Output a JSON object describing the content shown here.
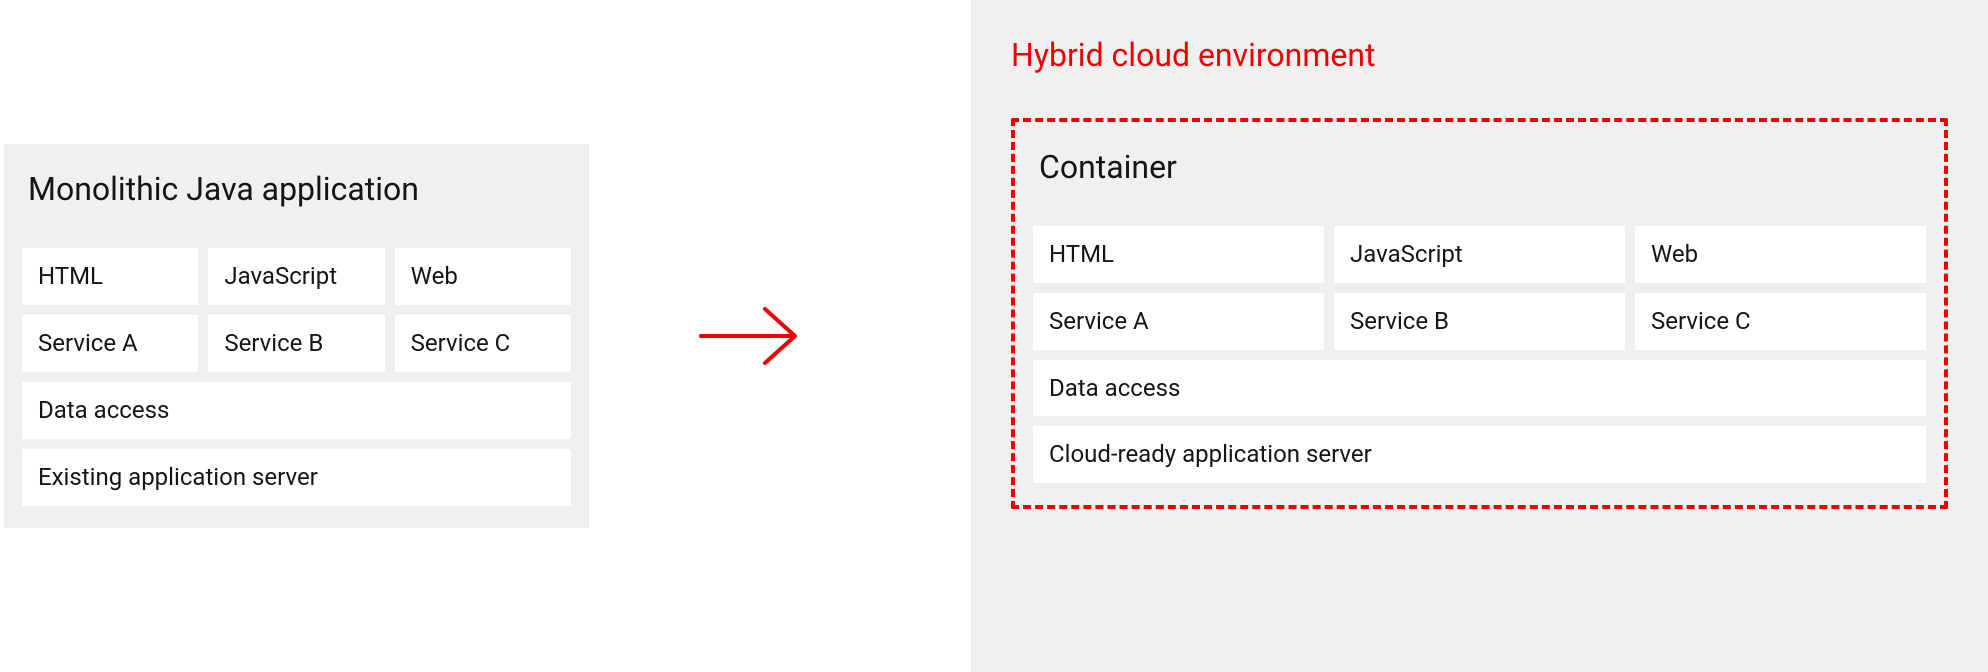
{
  "left": {
    "title": "Monolithic Java application",
    "grid": [
      "HTML",
      "JavaScript",
      "Web",
      "Service A",
      "Service B",
      "Service C"
    ],
    "rows": [
      "Data access",
      "Existing application server"
    ]
  },
  "right": {
    "env_title": "Hybrid cloud environment",
    "container_title": "Container",
    "grid": [
      "HTML",
      "JavaScript",
      "Web",
      "Service A",
      "Service B",
      "Service C"
    ],
    "rows": [
      "Data access",
      "Cloud-ready application server"
    ]
  },
  "colors": {
    "accent": "#ee0000",
    "panel_bg": "#f0f0f0",
    "cell_bg": "#ffffff",
    "text": "#151515"
  }
}
